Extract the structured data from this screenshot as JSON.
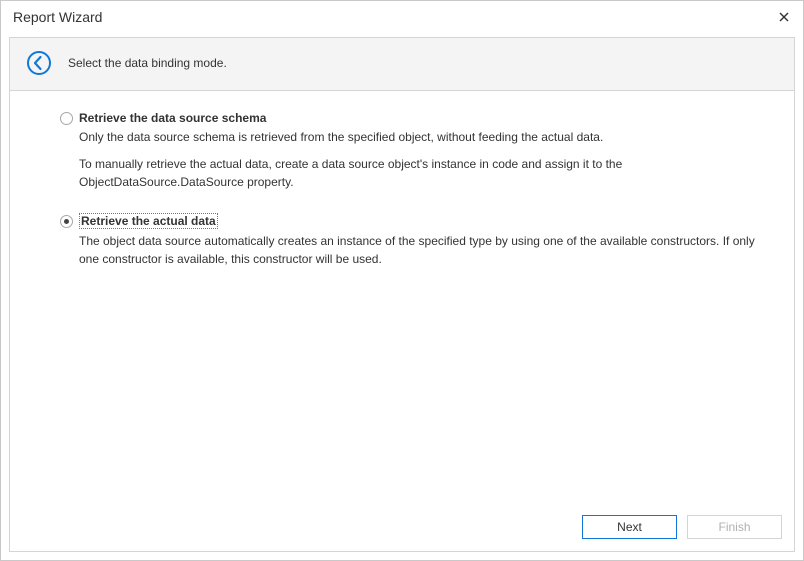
{
  "window": {
    "title": "Report Wizard"
  },
  "header": {
    "instruction": "Select the data binding mode."
  },
  "options": [
    {
      "id": "schema",
      "title": "Retrieve the data source schema",
      "selected": false,
      "focused": false,
      "descriptions": [
        "Only the data source schema is retrieved from the specified object, without feeding the actual data.",
        "To manually retrieve the actual data, create a data source object's instance in code and assign it to the ObjectDataSource.DataSource property."
      ]
    },
    {
      "id": "actual",
      "title": "Retrieve the actual data",
      "selected": true,
      "focused": true,
      "descriptions": [
        "The object data source automatically creates an instance of the specified type by using one of the available constructors. If only one constructor is available, this constructor will be used."
      ]
    }
  ],
  "buttons": {
    "next": "Next",
    "finish": "Finish"
  }
}
